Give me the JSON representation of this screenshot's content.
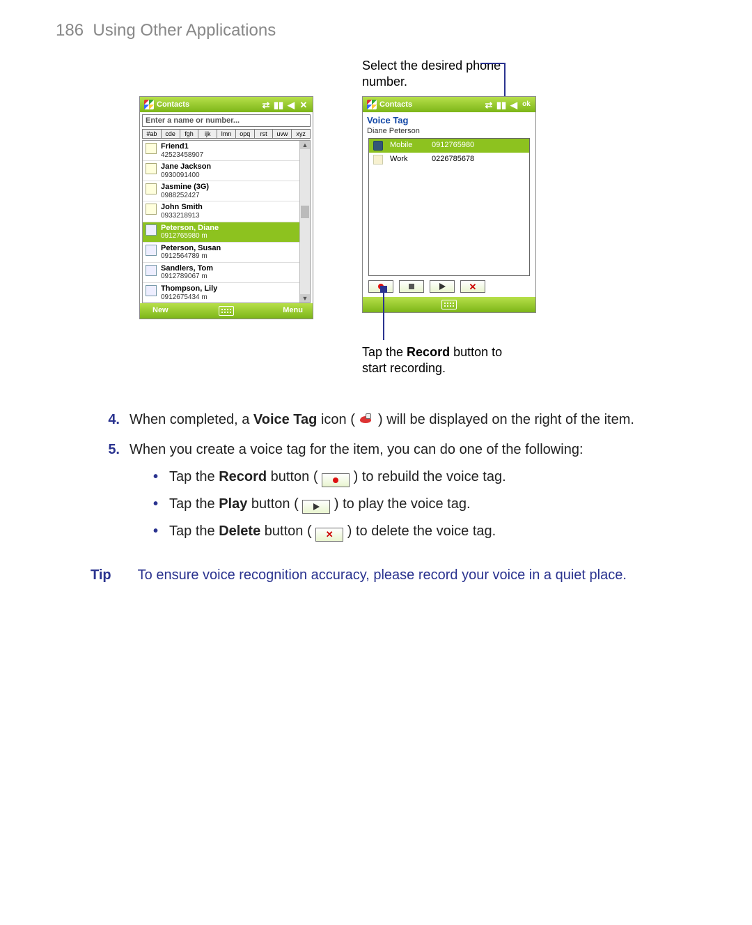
{
  "page": {
    "number": "186",
    "section": "Using Other Applications"
  },
  "callouts": {
    "top": "Select the desired phone number.",
    "bottom_prefix": "Tap the ",
    "bottom_bold": "Record",
    "bottom_suffix": " button to start recording."
  },
  "screen1": {
    "title": "Contacts",
    "search_placeholder": "Enter a name or number...",
    "alpha_tabs": [
      "#ab",
      "cde",
      "fgh",
      "ijk",
      "lmn",
      "opq",
      "rst",
      "uvw",
      "xyz"
    ],
    "contacts": [
      {
        "name": "Friend1",
        "detail": "42523458907",
        "card": false,
        "selected": false
      },
      {
        "name": "Jane Jackson",
        "detail": "0930091400",
        "card": false,
        "selected": false
      },
      {
        "name": "Jasmine (3G)",
        "detail": "0988252427",
        "card": false,
        "selected": false
      },
      {
        "name": "John Smith",
        "detail": "0933218913",
        "card": false,
        "selected": false
      },
      {
        "name": "Peterson, Diane",
        "detail": "0912765980   m",
        "card": true,
        "selected": true
      },
      {
        "name": "Peterson, Susan",
        "detail": "0912564789   m",
        "card": true,
        "selected": false
      },
      {
        "name": "Sandlers, Tom",
        "detail": "0912789067   m",
        "card": true,
        "selected": false
      },
      {
        "name": "Thompson, Lily",
        "detail": "0912675434   m",
        "card": true,
        "selected": false
      }
    ],
    "softkeys": {
      "left": "New",
      "right": "Menu"
    }
  },
  "screen2": {
    "title": "Contacts",
    "ok": "ok",
    "heading": "Voice Tag",
    "person": "Diane Peterson",
    "numbers": [
      {
        "kind": "Mobile",
        "value": "0912765980",
        "selected": true,
        "iconClass": "mobile"
      },
      {
        "kind": "Work",
        "value": "0226785678",
        "selected": false,
        "iconClass": "work"
      }
    ]
  },
  "steps": {
    "s4": {
      "num": "4.",
      "t1": "When completed, a ",
      "bold": "Voice Tag",
      "t2": " icon (",
      "t3": ") will be displayed on the right of the item."
    },
    "s5": {
      "num": "5.",
      "text": "When you create a voice tag for the item, you can do one of the following:"
    },
    "bullets": {
      "b1": {
        "t1": "Tap the ",
        "bold": "Record",
        "t2": " button (",
        "t3": ") to rebuild the voice tag."
      },
      "b2": {
        "t1": "Tap the ",
        "bold": "Play",
        "t2": " button (",
        "t3": ") to play the voice tag."
      },
      "b3": {
        "t1": "Tap the ",
        "bold": "Delete",
        "t2": " button (",
        "t3": ") to delete the voice tag."
      }
    }
  },
  "tip": {
    "label": "Tip",
    "text": "To ensure voice recognition accuracy, please record your voice in a quiet place."
  }
}
